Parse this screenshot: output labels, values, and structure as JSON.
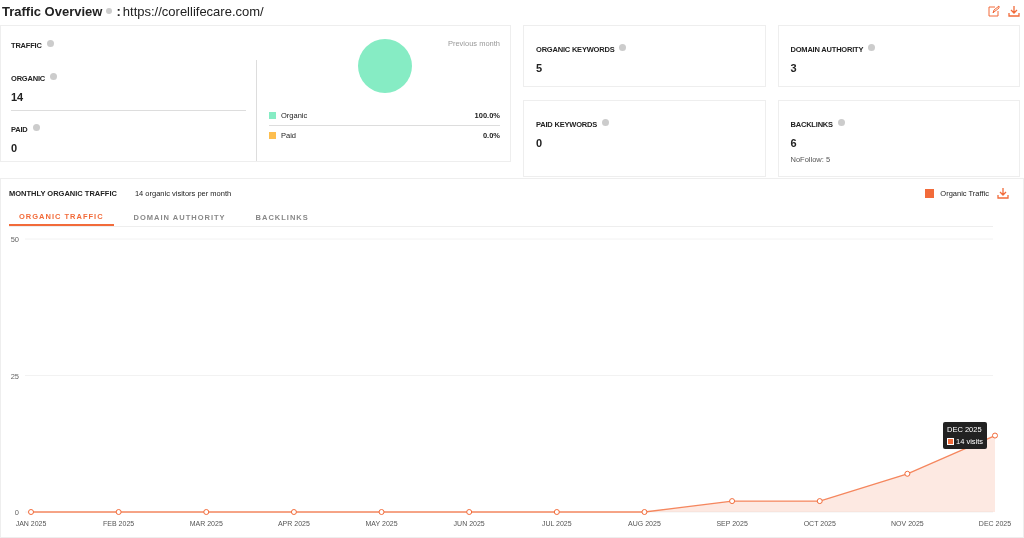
{
  "header": {
    "title": "Traffic Overview",
    "separator": ":",
    "url": "https://corellifecare.com/"
  },
  "traffic": {
    "title": "TRAFFIC",
    "period": "Previous month",
    "metrics": [
      {
        "label": "ORGANIC",
        "value": "14"
      },
      {
        "label": "PAID",
        "value": "0"
      }
    ],
    "chart_data": {
      "type": "pie",
      "categories": [
        "Organic",
        "Paid"
      ],
      "values": [
        100,
        0
      ]
    },
    "legend": [
      {
        "value": "100.0%",
        "color": "#86ecc4"
      },
      {
        "value": "0.0%",
        "color": "#fdbe4f"
      }
    ]
  },
  "stats": [
    {
      "label": "ORGANIC KEYWORDS",
      "value": "5"
    },
    {
      "label": "DOMAIN AUTHORITY",
      "value": "3"
    },
    {
      "label": "PAID KEYWORDS",
      "value": "0"
    },
    {
      "label": "BACKLINKS",
      "value": "6",
      "note": "NoFollow: 5"
    }
  ],
  "monthly": {
    "title": "MONTHLY ORGANIC TRAFFIC",
    "subtitle": "14 organic visitors per month",
    "tabs": [
      {
        "label": "ORGANIC TRAFFIC",
        "selected": true
      },
      {
        "label": "DOMAIN AUTHORITY",
        "selected": false
      },
      {
        "label": "BACKLINKS",
        "selected": false
      }
    ],
    "tooltip": {
      "title": "DEC 2025",
      "text": "14 visits"
    },
    "chart_data": {
      "type": "area",
      "categories": [
        "JAN 2025",
        "FEB 2025",
        "MAR 2025",
        "APR 2025",
        "MAY 2025",
        "JUN 2025",
        "JUL 2025",
        "AUG 2025",
        "SEP 2025",
        "OCT 2025",
        "NOV 2025",
        "DEC 2025"
      ],
      "series": [
        {
          "name": "Organic Traffic",
          "color": "#f26b3a",
          "values": [
            0,
            0,
            0,
            0,
            0,
            0,
            0,
            0,
            2,
            2,
            7,
            14
          ]
        }
      ],
      "ylim": [
        0,
        50
      ],
      "yticks": [
        0,
        25,
        50
      ]
    }
  }
}
